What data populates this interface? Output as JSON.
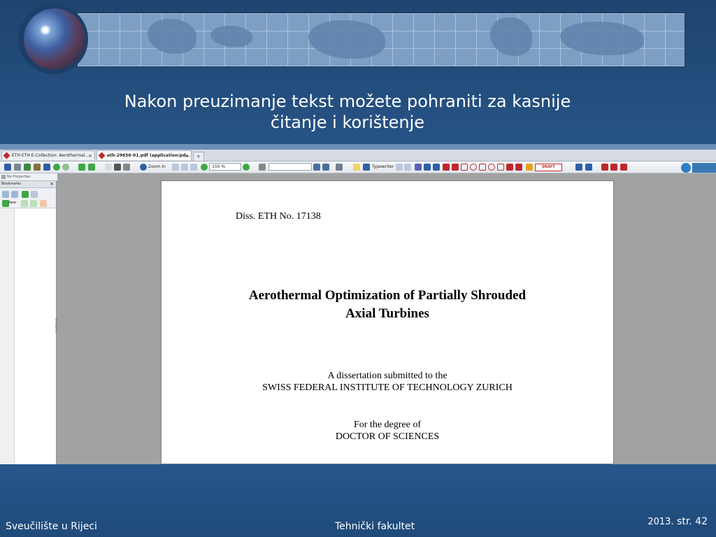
{
  "slide": {
    "title_line1": "Nakon preuzimanje tekst možete pohraniti za kasnije",
    "title_line2": "čitanje i korištenje",
    "footer_left": "Sveučilište u Rijeci",
    "footer_center": "Tehnički fakultet",
    "footer_year": "2013.",
    "footer_page": "str. 42"
  },
  "browser": {
    "tabs": [
      {
        "label": "ETH ETH E-Collection: Aerothermal...",
        "active": false,
        "close": "×"
      },
      {
        "label": "eth-29656-01.pdf (application/pd...",
        "active": true,
        "close": "×"
      }
    ],
    "new_tab": "+",
    "toolbar": {
      "zoom_in": "Zoom In",
      "zoom_value": "150 %",
      "typewriter": "Typewriter",
      "stamp": "DRAFT"
    },
    "no_properties": "No Properties",
    "bookmarks": {
      "title": "Bookmarks",
      "close": "×",
      "new_label": "New"
    }
  },
  "pdf": {
    "diss_no": "Diss. ETH No. 17138",
    "title_line1": "Aerothermal Optimization of Partially Shrouded",
    "title_line2": "Axial Turbines",
    "submitted_line1": "A dissertation submitted to the",
    "submitted_line2": "SWISS FEDERAL INSTITUTE OF TECHNOLOGY ZURICH",
    "degree_line1": "For the degree of",
    "degree_line2": "DOCTOR OF SCIENCES"
  },
  "icons": [
    "globe-icon",
    "pdf-tab-icon",
    "save-icon",
    "print-icon",
    "zoom-in-icon",
    "typewriter-icon",
    "highlight-icon",
    "pen-icon",
    "rectangle-icon",
    "ellipse-icon",
    "stamp-icon",
    "bookmark-add-icon"
  ]
}
